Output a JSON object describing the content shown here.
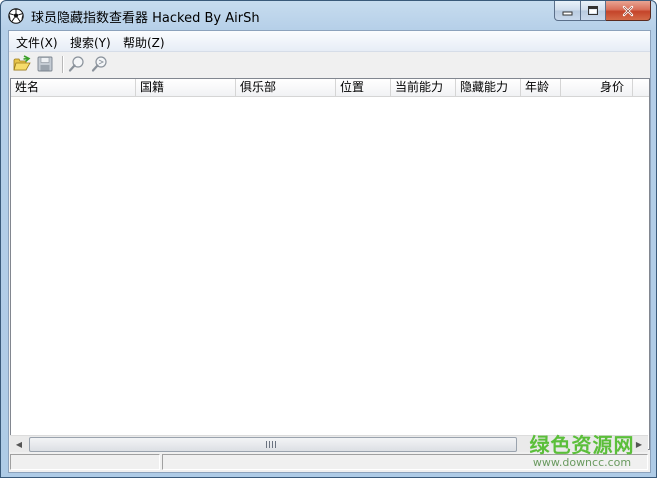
{
  "window": {
    "title": "球员隐藏指数查看器 Hacked By AirSh",
    "icon": "soccer-ball-icon"
  },
  "menu": [
    {
      "label": "文件(X)"
    },
    {
      "label": "搜索(Y)"
    },
    {
      "label": "帮助(Z)"
    }
  ],
  "toolbar": {
    "icons": [
      "open-folder-icon",
      "save-icon",
      "search-icon",
      "search-next-icon"
    ]
  },
  "table": {
    "columns": [
      "姓名",
      "国籍",
      "俱乐部",
      "位置",
      "当前能力",
      "隐藏能力",
      "年龄",
      "身价"
    ],
    "rows": []
  },
  "watermark": {
    "brand": "绿色资源网",
    "url": "www.downcc.com",
    "color": "#5bbf3a"
  }
}
